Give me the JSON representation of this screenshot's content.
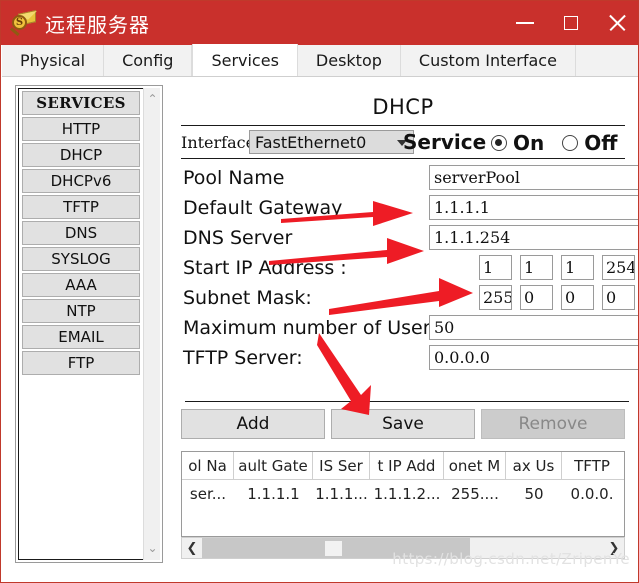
{
  "window": {
    "title": "远程服务器",
    "icon": "money-magnifier-envelope-icon",
    "accent_color": "#c9302c",
    "minimize_label": "—",
    "maximize_label": "□",
    "close_label": "×"
  },
  "tabs": [
    {
      "label": "Physical",
      "active": false
    },
    {
      "label": "Config",
      "active": false
    },
    {
      "label": "Services",
      "active": true
    },
    {
      "label": "Desktop",
      "active": false
    },
    {
      "label": "Custom Interface",
      "active": false
    }
  ],
  "sidebar": {
    "header": "SERVICES",
    "items": [
      {
        "label": "HTTP"
      },
      {
        "label": "DHCP"
      },
      {
        "label": "DHCPv6"
      },
      {
        "label": "TFTP"
      },
      {
        "label": "DNS"
      },
      {
        "label": "SYSLOG"
      },
      {
        "label": "AAA"
      },
      {
        "label": "NTP"
      },
      {
        "label": "EMAIL"
      },
      {
        "label": "FTP"
      }
    ],
    "scroll_up": "⌃",
    "scroll_down": "⌄"
  },
  "main": {
    "title": "DHCP",
    "interface": {
      "label": "Interface",
      "value": "FastEthernet0"
    },
    "service": {
      "label": "Service",
      "on_label": "On",
      "off_label": "Off",
      "selected": "On"
    },
    "fields": {
      "pool_name": {
        "label": "Pool Name",
        "value": "serverPool"
      },
      "default_gateway": {
        "label": "Default Gateway",
        "value": "1.1.1.1"
      },
      "dns_server": {
        "label": "DNS Server",
        "value": "1.1.1.254"
      },
      "start_ip_address": {
        "label": "Start IP Address :",
        "octets": [
          "1",
          "1",
          "1",
          "254"
        ]
      },
      "subnet_mask": {
        "label": "Subnet Mask:",
        "octets": [
          "255",
          "0",
          "0",
          "0"
        ]
      },
      "max_users": {
        "label": "Maximum number of Users :",
        "value": "50"
      },
      "tftp_server": {
        "label": "TFTP Server:",
        "value": "0.0.0.0"
      }
    },
    "buttons": {
      "add": "Add",
      "save": "Save",
      "remove": "Remove",
      "remove_disabled": true
    },
    "table": {
      "headers": [
        "ol Na",
        "ault Gate",
        "IS Ser",
        "t IP Add",
        "onet M",
        "ax Us",
        "TFTP"
      ],
      "rows": [
        [
          "ser...",
          "1.1.1.1",
          "1.1.1...",
          "1.1.1.2...",
          "255....",
          "50",
          "0.0.0."
        ]
      ]
    },
    "hscroll": {
      "left_arrow": "❮",
      "right_arrow": "❯"
    }
  },
  "watermark": "https://blog.csdn.net/ZripenYe"
}
